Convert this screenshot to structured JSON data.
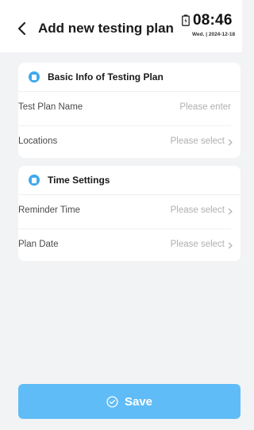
{
  "header": {
    "back_icon": "chevron-left-icon",
    "title": "Add new testing plan"
  },
  "status": {
    "battery_icon": "battery-icon",
    "time": "08:46",
    "date": "Wed. | 2024-12-18"
  },
  "sections": [
    {
      "icon": "document-icon",
      "title": "Basic Info of Testing Plan",
      "rows": [
        {
          "label": "Test Plan Name",
          "placeholder": "Please enter",
          "has_arrow": false
        },
        {
          "label": "Locations",
          "placeholder": "Please select",
          "has_arrow": true
        }
      ]
    },
    {
      "icon": "document-icon",
      "title": "Time Settings",
      "rows": [
        {
          "label": "Reminder Time",
          "placeholder": "Please select",
          "has_arrow": true
        },
        {
          "label": "Plan Date",
          "placeholder": "Please select",
          "has_arrow": true
        }
      ]
    }
  ],
  "save": {
    "icon": "check-circle-icon",
    "label": "Save"
  },
  "colors": {
    "accent": "#5fbcf6",
    "section_icon": "#3fa9ef",
    "background": "#f2f3f5",
    "placeholder": "#b0b0b0"
  }
}
